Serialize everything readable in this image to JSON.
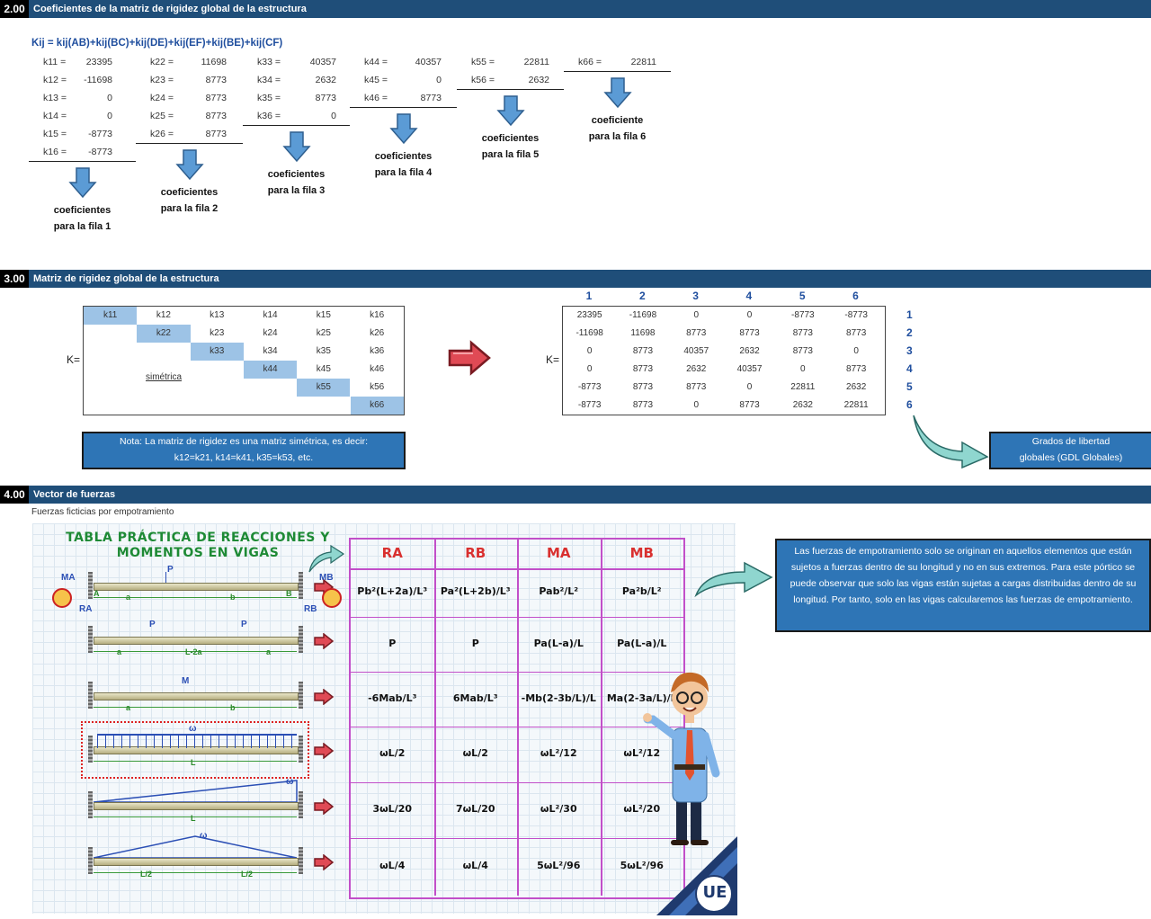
{
  "sections": {
    "s2": {
      "num": "2.00",
      "title": "Coeficientes de la matriz de rigidez global de la estructura"
    },
    "s3": {
      "num": "3.00",
      "title": "Matriz de rigidez global de la estructura"
    },
    "s4": {
      "num": "4.00",
      "title": "Vector de fuerzas"
    }
  },
  "kij_formula": "Kij = kij(AB)+kij(BC)+kij(DE)+kij(EF)+kij(BE)+kij(CF)",
  "coef_columns": [
    {
      "items": [
        [
          "k11 =",
          "23395"
        ],
        [
          "k12 =",
          "-11698"
        ],
        [
          "k13 =",
          "0"
        ],
        [
          "k14 =",
          "0"
        ],
        [
          "k15 =",
          "-8773"
        ],
        [
          "k16 =",
          "-8773"
        ]
      ],
      "label1": "coeficientes",
      "label2": "para la fila 1"
    },
    {
      "items": [
        [
          "k22 =",
          "11698"
        ],
        [
          "k23 =",
          "8773"
        ],
        [
          "k24 =",
          "8773"
        ],
        [
          "k25 =",
          "8773"
        ],
        [
          "k26 =",
          "8773"
        ]
      ],
      "label1": "coeficientes",
      "label2": "para la fila 2"
    },
    {
      "items": [
        [
          "k33 =",
          "40357"
        ],
        [
          "k34 =",
          "2632"
        ],
        [
          "k35 =",
          "8773"
        ],
        [
          "k36 =",
          "0"
        ]
      ],
      "label1": "coeficientes",
      "label2": "para la fila 3"
    },
    {
      "items": [
        [
          "k44 =",
          "40357"
        ],
        [
          "k45 =",
          "0"
        ],
        [
          "k46 =",
          "8773"
        ]
      ],
      "label1": "coeficientes",
      "label2": "para la fila 4"
    },
    {
      "items": [
        [
          "k55 =",
          "22811"
        ],
        [
          "k56 =",
          "2632"
        ]
      ],
      "label1": "coeficientes",
      "label2": "para la fila 5"
    },
    {
      "items": [
        [
          "k66 =",
          "22811"
        ]
      ],
      "label1": "coeficiente",
      "label2": "para la fila 6"
    }
  ],
  "sym_matrix": {
    "k_label": "K=",
    "rows": [
      [
        "k11",
        "k12",
        "k13",
        "k14",
        "k15",
        "k16"
      ],
      [
        "",
        "k22",
        "k23",
        "k24",
        "k25",
        "k26"
      ],
      [
        "",
        "",
        "k33",
        "k34",
        "k35",
        "k36"
      ],
      [
        "",
        "",
        "",
        "k44",
        "k45",
        "k46"
      ],
      [
        "",
        "",
        "",
        "",
        "k55",
        "k56"
      ],
      [
        "",
        "",
        "",
        "",
        "",
        "k66"
      ]
    ],
    "sym_label": "simétrica"
  },
  "num_matrix": {
    "k_label": "K=",
    "col_headers": [
      "1",
      "2",
      "3",
      "4",
      "5",
      "6"
    ],
    "row_headers": [
      "1",
      "2",
      "3",
      "4",
      "5",
      "6"
    ],
    "rows": [
      [
        "23395",
        "-11698",
        "0",
        "0",
        "-8773",
        "-8773"
      ],
      [
        "-11698",
        "11698",
        "8773",
        "8773",
        "8773",
        "8773"
      ],
      [
        "0",
        "8773",
        "40357",
        "2632",
        "8773",
        "0"
      ],
      [
        "0",
        "8773",
        "2632",
        "40357",
        "0",
        "8773"
      ],
      [
        "-8773",
        "8773",
        "8773",
        "0",
        "22811",
        "2632"
      ],
      [
        "-8773",
        "8773",
        "0",
        "8773",
        "2632",
        "22811"
      ]
    ]
  },
  "note": {
    "line1": "Nota: La matriz de rigidez es una matriz simétrica, es decir:",
    "line2": "k12=k21, k14=k41, k35=k53, etc."
  },
  "gdl_box": {
    "line1": "Grados de libertad",
    "line2": "globales (GDL Globales)"
  },
  "forces_subtitle": "Fuerzas ficticias por empotramiento",
  "table_title": {
    "line1": "TABLA PRÁCTICA DE REACCIONES Y",
    "line2": "MOMENTOS EN VIGAS"
  },
  "table_headers": [
    "RA",
    "RB",
    "MA",
    "MB"
  ],
  "table_rows": [
    [
      "Pb²(L+2a)/L³",
      "Pa²(L+2b)/L³",
      "Pab²/L²",
      "Pa²b/L²"
    ],
    [
      "P",
      "P",
      "Pa(L-a)/L",
      "Pa(L-a)/L"
    ],
    [
      "-6Mab/L³",
      "6Mab/L³",
      "-Mb(2-3b/L)/L",
      "Ma(2-3a/L)/L"
    ],
    [
      "ωL/2",
      "ωL/2",
      "ωL²/12",
      "ωL²/12"
    ],
    [
      "3ωL/20",
      "7ωL/20",
      "ωL²/30",
      "ωL²/20"
    ],
    [
      "ωL/4",
      "ωL/4",
      "5ωL²/96",
      "5ωL²/96"
    ]
  ],
  "beam_labels": {
    "p": "P",
    "m": "M",
    "w": "ω",
    "a": "a",
    "b": "b",
    "l": "L",
    "l2a": "L-2a",
    "lhalf": "L/2",
    "ma": "MA",
    "mb": "MB",
    "ra": "RA",
    "rb": "RB",
    "A": "A",
    "B": "B"
  },
  "info_box": "Las fuerzas de empotramiento solo se originan en aquellos elementos que están sujetos a fuerzas dentro de su longitud y no en sus extremos. Para este pórtico se puede observar que solo las vigas están sujetas a cargas distribuidas dentro de su longitud. Por tanto, solo en las vigas calcularemos las fuerzas de empotramiento.",
  "logo_text": "UE",
  "colors": {
    "header": "#1f4e79",
    "accent_blue": "#2e75b6",
    "diag": "#9dc3e6",
    "table_border": "#c24fc9",
    "table_head": "#d9302f",
    "title_green": "#1e8a35"
  }
}
